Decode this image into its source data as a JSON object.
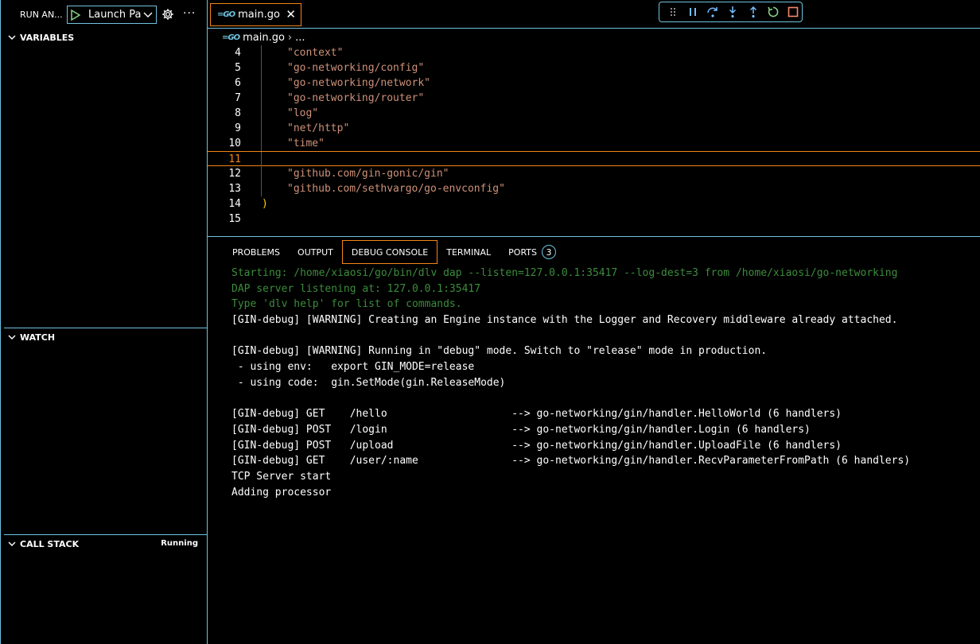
{
  "sidebar": {
    "run_title": "RUN AN...",
    "launch_label": "Launch Package",
    "sections": {
      "variables": "VARIABLES",
      "watch": "WATCH",
      "callstack": "CALL STACK",
      "callstack_status": "Running"
    }
  },
  "editor": {
    "tab_label": "main.go",
    "breadcrumb": {
      "file": "main.go",
      "ellipsis": "..."
    },
    "lines": [
      {
        "num": "4",
        "text": "\"context\""
      },
      {
        "num": "5",
        "text": "\"go-networking/config\""
      },
      {
        "num": "6",
        "text": "\"go-networking/network\""
      },
      {
        "num": "7",
        "text": "\"go-networking/router\""
      },
      {
        "num": "8",
        "text": "\"log\""
      },
      {
        "num": "9",
        "text": "\"net/http\""
      },
      {
        "num": "10",
        "text": "\"time\""
      },
      {
        "num": "11",
        "text": ""
      },
      {
        "num": "12",
        "text": "\"github.com/gin-gonic/gin\""
      },
      {
        "num": "13",
        "text": "\"github.com/sethvargo/go-envconfig\""
      },
      {
        "num": "14",
        "text": ")"
      },
      {
        "num": "15",
        "text": ""
      }
    ]
  },
  "panel": {
    "tabs": [
      "PROBLEMS",
      "OUTPUT",
      "DEBUG CONSOLE",
      "TERMINAL",
      "PORTS"
    ],
    "ports_count": "3",
    "console": [
      {
        "text": "Starting: /home/xiaosi/go/bin/dlv dap --listen=127.0.0.1:35417 --log-dest=3 from /home/xiaosi/go-networking",
        "color": "green"
      },
      {
        "text": "DAP server listening at: 127.0.0.1:35417",
        "color": "green"
      },
      {
        "text": "Type 'dlv help' for list of commands.",
        "color": "green"
      },
      {
        "text": "[GIN-debug] [WARNING] Creating an Engine instance with the Logger and Recovery middleware already attached.",
        "color": "white"
      },
      {
        "text": "",
        "color": "white"
      },
      {
        "text": "[GIN-debug] [WARNING] Running in \"debug\" mode. Switch to \"release\" mode in production.",
        "color": "white"
      },
      {
        "text": " - using env:   export GIN_MODE=release",
        "color": "white"
      },
      {
        "text": " - using code:  gin.SetMode(gin.ReleaseMode)",
        "color": "white"
      },
      {
        "text": "",
        "color": "white"
      },
      {
        "text": "[GIN-debug] GET    /hello                    --> go-networking/gin/handler.HelloWorld (6 handlers)",
        "color": "white"
      },
      {
        "text": "[GIN-debug] POST   /login                    --> go-networking/gin/handler.Login (6 handlers)",
        "color": "white"
      },
      {
        "text": "[GIN-debug] POST   /upload                   --> go-networking/gin/handler.UploadFile (6 handlers)",
        "color": "white"
      },
      {
        "text": "[GIN-debug] GET    /user/:name               --> go-networking/gin/handler.RecvParameterFromPath (6 handlers)",
        "color": "white"
      },
      {
        "text": "TCP Server start",
        "color": "white"
      },
      {
        "text": "Adding processor",
        "color": "white"
      }
    ]
  },
  "colors": {
    "accent_border": "#6fc3df",
    "focus_border": "#f38518",
    "string": "#ce9178",
    "console_info": "#3c8c3c"
  }
}
